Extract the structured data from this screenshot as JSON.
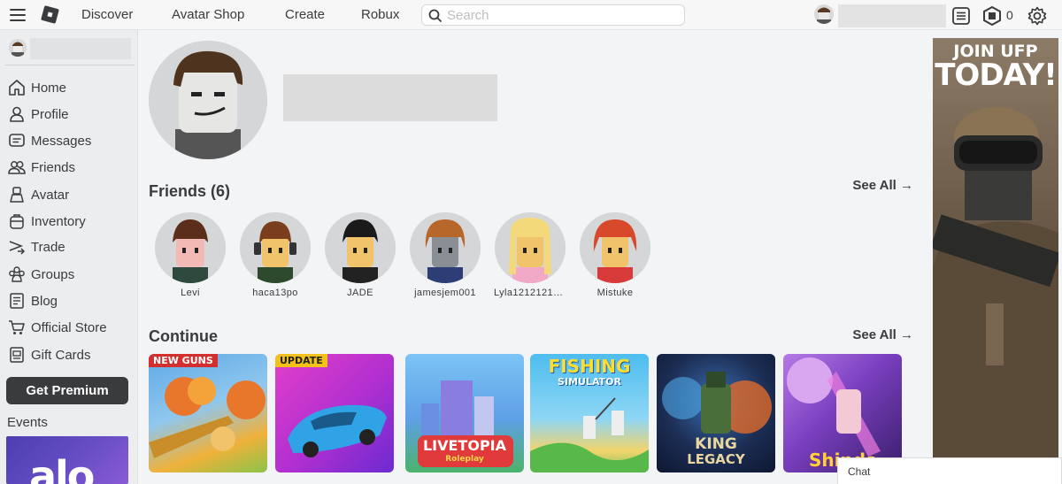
{
  "topbar": {
    "menu_icon": "hamburger-menu-icon",
    "logo_icon": "roblox-logo-icon",
    "nav": [
      "Discover",
      "Avatar Shop",
      "Create",
      "Robux"
    ],
    "search_placeholder": "Search",
    "robux_count": "0",
    "icons": [
      "notifications-icon",
      "robux-icon",
      "settings-gear-icon"
    ]
  },
  "sidebar": {
    "items": [
      {
        "label": "Home",
        "icon": "home-icon"
      },
      {
        "label": "Profile",
        "icon": "profile-icon"
      },
      {
        "label": "Messages",
        "icon": "messages-icon"
      },
      {
        "label": "Friends",
        "icon": "friends-icon"
      },
      {
        "label": "Avatar",
        "icon": "avatar-icon"
      },
      {
        "label": "Inventory",
        "icon": "inventory-icon"
      },
      {
        "label": "Trade",
        "icon": "trade-icon"
      },
      {
        "label": "Groups",
        "icon": "groups-icon"
      },
      {
        "label": "Blog",
        "icon": "blog-icon"
      },
      {
        "label": "Official Store",
        "icon": "store-icon"
      },
      {
        "label": "Gift Cards",
        "icon": "gift-card-icon"
      }
    ],
    "premium_button": "Get Premium",
    "events_label": "Events",
    "event_banner_text": "alo"
  },
  "main": {
    "friends_title": "Friends (6)",
    "see_all": "See All →",
    "friends": [
      "Levi",
      "haca13po",
      "JADE",
      "jamesjem001",
      "Lyla1212121​2...",
      "Mistuke"
    ],
    "continue_title": "Continue",
    "games": [
      {
        "badge": "NEW GUNS",
        "title": "",
        "colors": [
          "#6fb6e8",
          "#f0b13a"
        ]
      },
      {
        "badge": "UPDATE",
        "title": "",
        "colors": [
          "#d93ac3",
          "#7b2fd1"
        ]
      },
      {
        "badge": "",
        "title": "LIVETOPIA",
        "subtitle": "Roleplay",
        "colors": [
          "#6fb2f0",
          "#3c7dd8"
        ]
      },
      {
        "badge": "",
        "title": "FISHING",
        "subtitle": "SIMULATOR",
        "colors": [
          "#5ec6f2",
          "#f2d46b"
        ]
      },
      {
        "badge": "",
        "title": "KING",
        "subtitle": "LEGACY",
        "colors": [
          "#1e3e6b",
          "#c4552a"
        ]
      },
      {
        "badge": "",
        "title": "Shinds",
        "colors": [
          "#6f3fae",
          "#e07bd8"
        ]
      }
    ]
  },
  "ad": {
    "line1": "JOIN UFP",
    "line2": "TODAY!"
  },
  "chat": {
    "label": "Chat"
  }
}
